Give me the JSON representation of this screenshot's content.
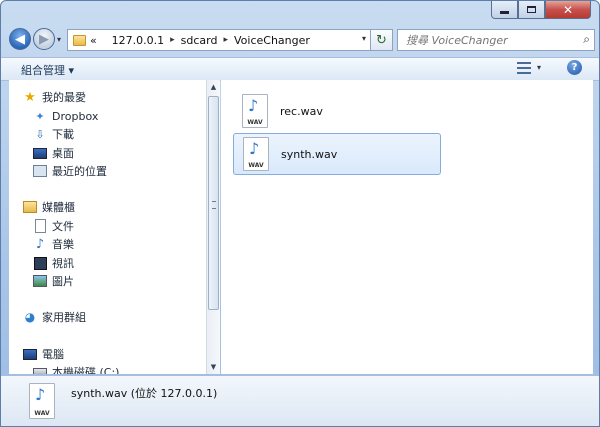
{
  "address": {
    "history_marker": "«",
    "crumbs": [
      "127.0.0.1",
      "sdcard",
      "VoiceChanger"
    ]
  },
  "search": {
    "placeholder": "搜尋 VoiceChanger"
  },
  "toolbar": {
    "organize_label": "組合管理 ▾"
  },
  "nav": {
    "favorites_label": "我的最愛",
    "favorites": [
      "Dropbox",
      "下載",
      "桌面",
      "最近的位置"
    ],
    "libraries_label": "媒體櫃",
    "libraries": [
      "文件",
      "音樂",
      "視訊",
      "圖片"
    ],
    "homegroup_label": "家用群組",
    "computer_label": "電腦",
    "computer_items": [
      "本機磁碟 (C:)"
    ]
  },
  "files": [
    {
      "name": "rec.wav",
      "type_label": "WAV",
      "selected": false
    },
    {
      "name": "synth.wav",
      "type_label": "WAV",
      "selected": true
    }
  ],
  "details": {
    "text": "synth.wav (位於 127.0.0.1)",
    "type_label": "WAV"
  },
  "colors": {
    "accent": "#2b78c5",
    "selection": "#d9e9fb",
    "close_button": "#c75050"
  }
}
